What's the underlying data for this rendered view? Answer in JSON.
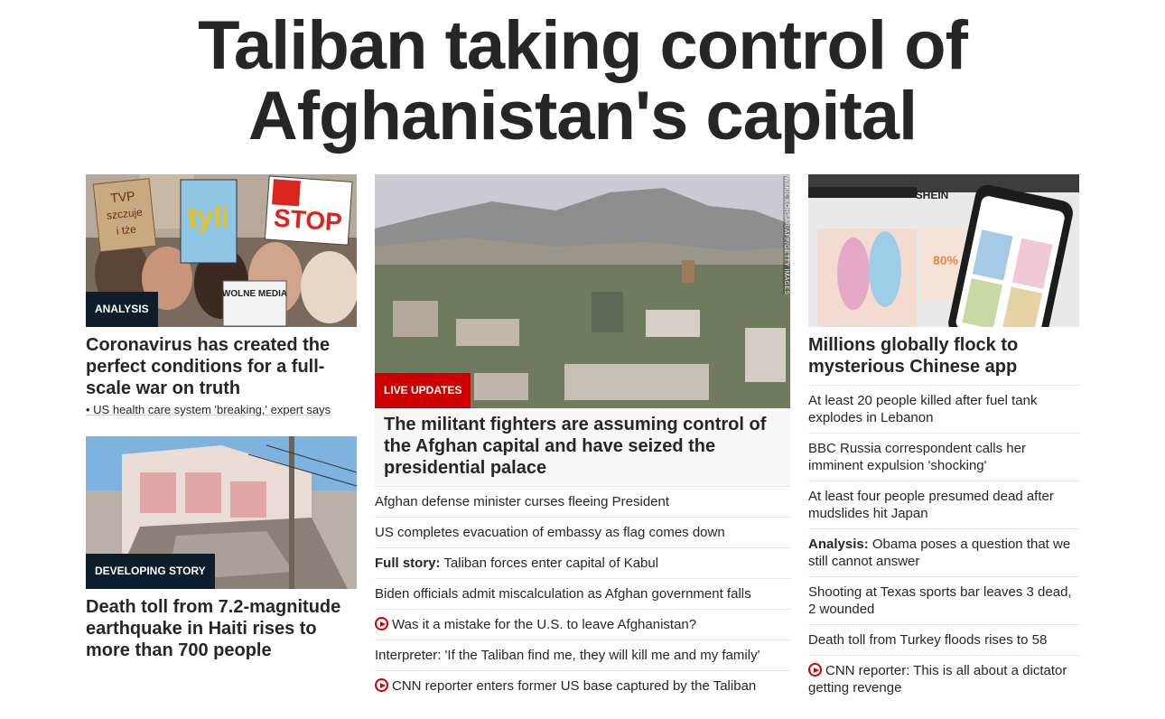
{
  "headline": "Taliban taking control of Afghanistan's capital",
  "left": {
    "story1": {
      "badge": "ANALYSIS",
      "title": "Coronavirus has created the perfect conditions for a full-scale war on truth",
      "sub": "US health care system 'breaking,' expert says",
      "image_text": {
        "sign1": "TVP szczuje i tże",
        "sign2": "tyli",
        "sign3": "STOP",
        "sign4": "WOLNE MEDIA"
      }
    },
    "story2": {
      "badge": "DEVELOPING STORY",
      "title": "Death toll from 7.2-magnitude earthquake in Haiti rises to more than 700 people"
    }
  },
  "mid": {
    "credit": "WAKIL KOHSAR/AFP/GETTY IMAGES",
    "badge": "LIVE UPDATES",
    "title": "The militant fighters are assuming control of the Afghan capital and have seized the presidential palace",
    "items": [
      {
        "prefix": "",
        "text": "Afghan defense minister curses fleeing President",
        "video": false
      },
      {
        "prefix": "",
        "text": "US completes evacuation of embassy as flag comes down",
        "video": false
      },
      {
        "prefix": "Full story:",
        "text": "Taliban forces enter capital of Kabul",
        "video": false
      },
      {
        "prefix": "",
        "text": "Biden officials admit miscalculation as Afghan government falls",
        "video": false
      },
      {
        "prefix": "",
        "text": "Was it a mistake for the U.S. to leave Afghanistan?",
        "video": true
      },
      {
        "prefix": "",
        "text": "Interpreter: 'If the Taliban find me, they will kill me and my family'",
        "video": false
      },
      {
        "prefix": "",
        "text": "CNN reporter enters former US base captured by the Taliban",
        "video": true
      }
    ]
  },
  "right": {
    "title": "Millions globally flock to mysterious Chinese app",
    "image_text": {
      "brand": "SHEIN",
      "promo": "MATCHING APP 80%"
    },
    "items": [
      {
        "prefix": "",
        "text": "At least 20 people killed after fuel tank explodes in Lebanon",
        "video": false
      },
      {
        "prefix": "",
        "text": "BBC Russia correspondent calls her imminent expulsion 'shocking'",
        "video": false
      },
      {
        "prefix": "",
        "text": "At least four people presumed dead after mudslides hit Japan",
        "video": false
      },
      {
        "prefix": "Analysis:",
        "text": "Obama poses a question that we still cannot answer",
        "video": false
      },
      {
        "prefix": "",
        "text": "Shooting at Texas sports bar leaves 3 dead, 2 wounded",
        "video": false
      },
      {
        "prefix": "",
        "text": "Death toll from Turkey floods rises to 58",
        "video": false
      },
      {
        "prefix": "",
        "text": "CNN reporter: This is all about a dictator getting revenge",
        "video": true
      }
    ]
  }
}
